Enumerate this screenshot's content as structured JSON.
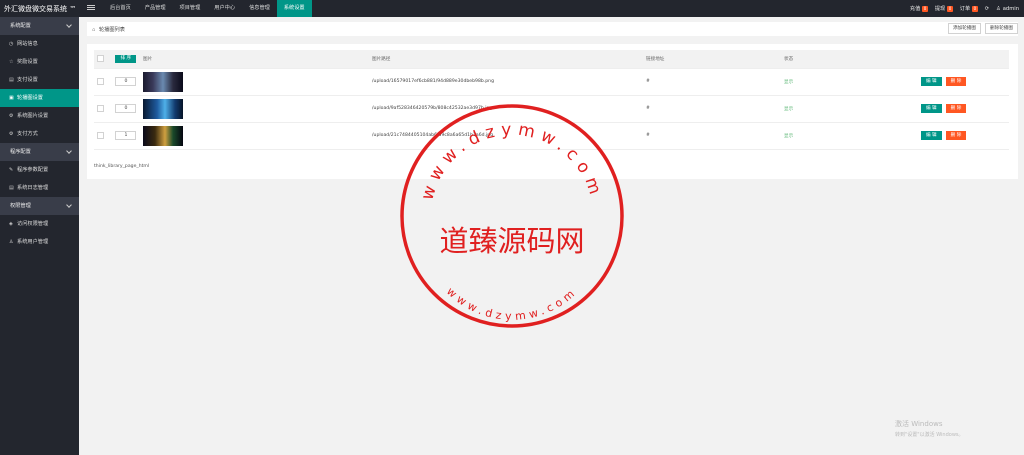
{
  "app": {
    "title": "外汇微盘微交易系统 ™"
  },
  "topnav": [
    {
      "label": "后台首页",
      "active": false
    },
    {
      "label": "产品管理",
      "active": false
    },
    {
      "label": "项目管理",
      "active": false
    },
    {
      "label": "用户中心",
      "active": false
    },
    {
      "label": "信息管理",
      "active": false
    },
    {
      "label": "系统设置",
      "active": true
    }
  ],
  "topright": {
    "recharge": {
      "label": "充值",
      "count": "0"
    },
    "withdraw": {
      "label": "提现",
      "count": "0"
    },
    "orders": {
      "label": "订单",
      "count": "0"
    },
    "user": "admin"
  },
  "sidebar": {
    "groups": [
      {
        "label": "系统配置",
        "items": [
          {
            "label": "网站信息",
            "icon": "clock-icon",
            "glyph": "◷",
            "active": false
          },
          {
            "label": "奖励设置",
            "icon": "star-icon",
            "glyph": "☆",
            "active": false
          },
          {
            "label": "支付设置",
            "icon": "card-icon",
            "glyph": "▤",
            "active": false
          },
          {
            "label": "轮播图设置",
            "icon": "image-icon",
            "glyph": "▣",
            "active": true
          },
          {
            "label": "系统图片设置",
            "icon": "gear-icon",
            "glyph": "⚙",
            "active": false
          },
          {
            "label": "支付方式",
            "icon": "settings-icon",
            "glyph": "⚙",
            "active": false
          }
        ]
      },
      {
        "label": "程序配置",
        "items": [
          {
            "label": "程序参数配置",
            "icon": "wrench-icon",
            "glyph": "✎",
            "active": false
          },
          {
            "label": "系统日志管理",
            "icon": "log-icon",
            "glyph": "▤",
            "active": false
          }
        ]
      },
      {
        "label": "权限管理",
        "items": [
          {
            "label": "访问权限管理",
            "icon": "shield-icon",
            "glyph": "◈",
            "active": false
          },
          {
            "label": "系统用户管理",
            "icon": "user-icon",
            "glyph": "♙",
            "active": false
          }
        ]
      }
    ]
  },
  "page": {
    "breadcrumb": "轮播图列表",
    "add_button": "添加轮播图",
    "delete_button": "删除轮播图"
  },
  "table": {
    "sort_button": "排 序",
    "headers": {
      "image": "图片",
      "path": "图片路径",
      "link": "链接地址",
      "status": "状态"
    },
    "rows": [
      {
        "sort": "0",
        "thumb": "t1",
        "path": "/upload/16579017ef6cb881/94d889e30dbeb98b.png",
        "link": "#",
        "status": "显示",
        "edit": "编 辑",
        "delete": "删 除"
      },
      {
        "sort": "0",
        "thumb": "t2",
        "path": "/upload/9af528346420579b/808c42532ae3d97b.jpg",
        "link": "#",
        "status": "显示",
        "edit": "编 辑",
        "delete": "删 除"
      },
      {
        "sort": "1",
        "thumb": "t3",
        "path": "/upload/21c7484405104ab6/d9c8a6a65d1b1a6d.jpg",
        "link": "#",
        "status": "显示",
        "edit": "编 辑",
        "delete": "删 除"
      }
    ]
  },
  "footer_text": "think_library_page_html",
  "stamp": {
    "main_text": "道臻源码网",
    "top_arc": "www.dzymw.com",
    "bottom_arc": "www.dzymw.com",
    "color": "#e02020"
  },
  "watermark": {
    "line1": "激活 Windows",
    "line2": "转到\"设置\"以激活 Windows。"
  },
  "colors": {
    "accent": "#009688",
    "danger": "#ff5722",
    "success": "#5fb878",
    "dark": "#23262e"
  }
}
